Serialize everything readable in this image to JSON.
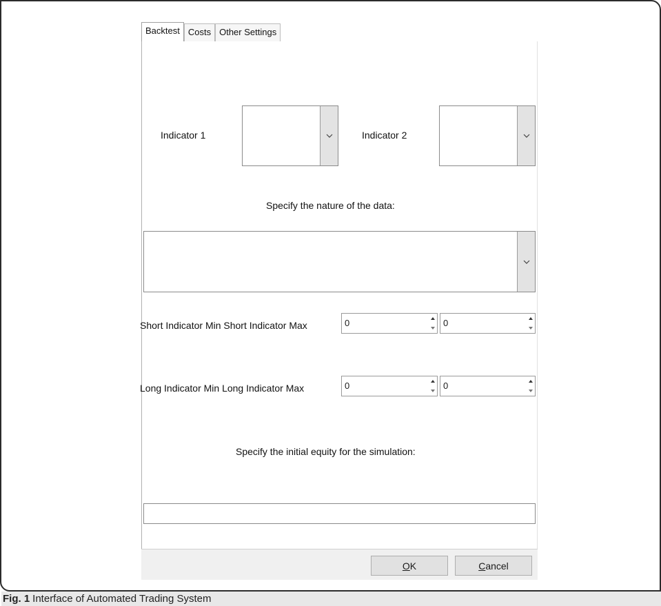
{
  "tabs": [
    "Backtest",
    "Costs",
    "Other Settings"
  ],
  "indicator1_label": "Indicator 1",
  "indicator2_label": "Indicator 2",
  "data_nature_label": "Specify the nature of the data:",
  "short_indicator_label": "Short Indicator Min Short Indicator Max",
  "long_indicator_label": "Long Indicator Min Long Indicator Max",
  "short_min_value": "0",
  "short_max_value": "0",
  "long_min_value": "0",
  "long_max_value": "0",
  "initial_equity_label": "Specify the initial equity for the simulation:",
  "initial_equity_value": "",
  "ok_button": {
    "accel": "O",
    "rest": "K"
  },
  "cancel_button": {
    "accel": "C",
    "rest": "ancel"
  },
  "caption": {
    "fig": "Fig. 1",
    "text": "Interface of Automated Trading System"
  }
}
